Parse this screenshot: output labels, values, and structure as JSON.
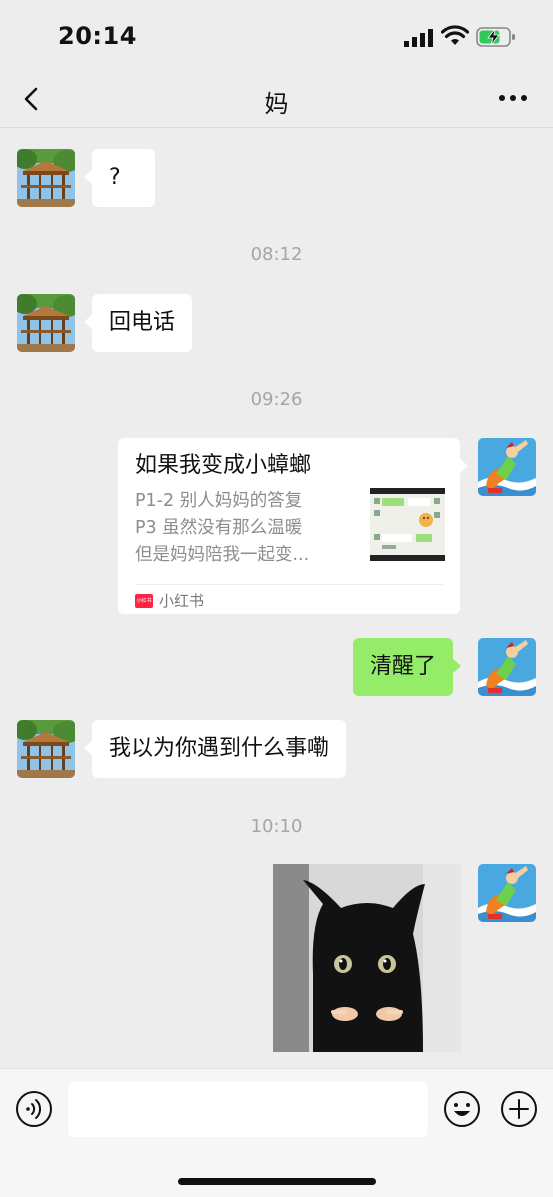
{
  "status_bar": {
    "time": "20:14"
  },
  "nav": {
    "title": "妈",
    "back_icon": "chevron-left-icon",
    "more_icon": "more-horizontal-icon"
  },
  "messages": {
    "m1": "?",
    "t1": "08:12",
    "m2": "回电话",
    "t2": "09:26",
    "share": {
      "title": "如果我变成小蟑螂",
      "desc1": "P1-2 别人妈妈的答复",
      "desc2": "P3 虽然没有那么温暖",
      "desc3": "但是妈妈陪我一起变...",
      "source": "小红书",
      "logo_text": "小红书"
    },
    "m3": "清醒了",
    "m4": "我以为你遇到什么事嘞",
    "t3": "10:10"
  },
  "input_bar": {
    "voice_icon": "voice-icon",
    "emoji_icon": "emoji-icon",
    "plus_icon": "plus-icon",
    "text_value": ""
  },
  "colors": {
    "background": "#ededed",
    "outgoing_bubble": "#95ec69",
    "incoming_bubble": "#ffffff",
    "timestamp": "#a5a5a5",
    "xhs_brand": "#ff2442"
  }
}
